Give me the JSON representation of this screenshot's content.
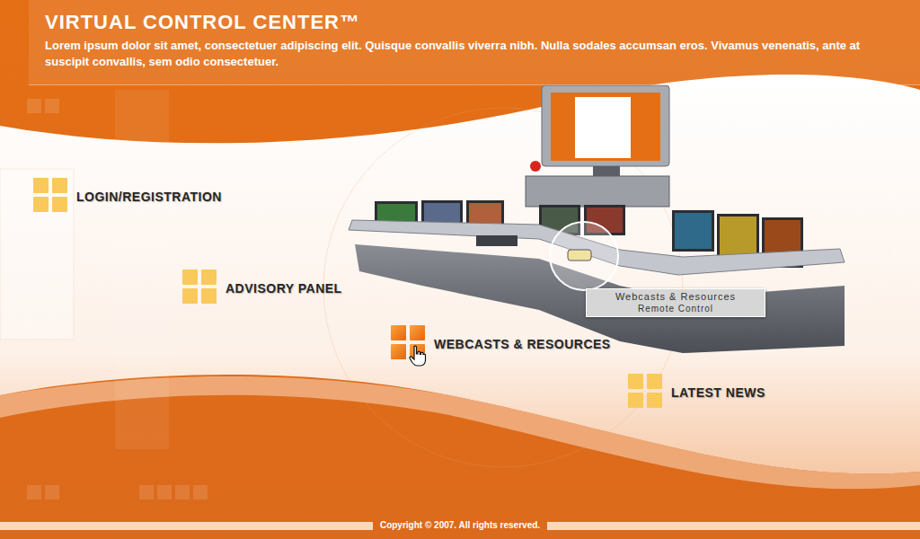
{
  "header": {
    "title": "VIRTUAL CONTROL CENTER™",
    "description": "Lorem ipsum dolor sit amet, consectetuer adipiscing elit. Quisque convallis viverra nibh. Nulla sodales accumsan eros. Vivamus venenatis, ante at suscipit convallis, sem odio consectetuer."
  },
  "menu": [
    {
      "label": "LOGIN/REGISTRATION",
      "selected": false
    },
    {
      "label": "ADVISORY PANEL",
      "selected": false
    },
    {
      "label": "WEBCASTS & RESOURCES",
      "selected": true
    },
    {
      "label": "LATEST NEWS",
      "selected": false
    }
  ],
  "tooltip": {
    "title": "Webcasts & Resources",
    "subtitle": "Remote Control"
  },
  "footer": {
    "copyright": "Copyright © 2007. All rights reserved."
  }
}
